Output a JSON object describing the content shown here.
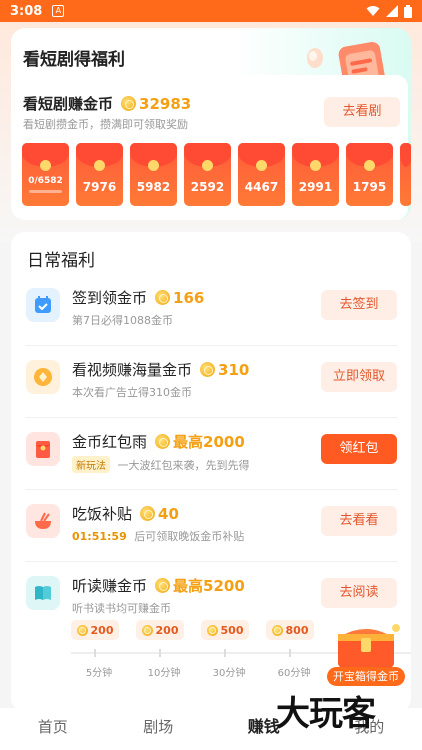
{
  "status_bar": {
    "time": "3:08",
    "a_badge": "A",
    "icons": [
      "wifi-icon",
      "signal-icon",
      "battery-icon"
    ]
  },
  "drama_card": {
    "title": "看短剧得福利",
    "earn_label": "看短剧赚金币",
    "coins": "32983",
    "subtitle": "看短剧攒金币，攒满即可领取奖励",
    "button": "去看剧",
    "envelopes": [
      {
        "value": "0/6582",
        "progress": 0
      },
      {
        "value": "7976"
      },
      {
        "value": "5982"
      },
      {
        "value": "2592"
      },
      {
        "value": "4467"
      },
      {
        "value": "2991"
      },
      {
        "value": "1795"
      }
    ]
  },
  "daily": {
    "title": "日常福利",
    "tasks": [
      {
        "title": "签到领金币",
        "reward": "166",
        "desc": "第7日必得1088金币",
        "button": "去签到",
        "icon": "calendar-icon"
      },
      {
        "title": "看视频赚海量金币",
        "reward": "310",
        "desc": "本次看广告立得310金币",
        "button": "立即领取",
        "icon": "video-coin-icon"
      },
      {
        "title": "金币红包雨",
        "reward": "最高2000",
        "tag": "新玩法",
        "desc": "一大波红包来袭，先到先得",
        "button": "领红包",
        "icon": "red-packet-icon"
      },
      {
        "title": "吃饭补贴",
        "reward": "40",
        "timer": "01:51:59",
        "desc": "后可领取晚饭金币补贴",
        "button": "去看看",
        "icon": "bowl-icon"
      },
      {
        "title": "听读赚金币",
        "reward": "最高5200",
        "desc": "听书读书均可赚金币",
        "button": "去阅读",
        "icon": "book-icon"
      }
    ],
    "listen_chips": [
      "200",
      "200",
      "500",
      "800"
    ],
    "listen_times": [
      "5分钟",
      "10分钟",
      "30分钟",
      "60分钟"
    ]
  },
  "treasure": {
    "label": "开宝箱得金币"
  },
  "bottom_nav": {
    "items": [
      "首页",
      "剧场",
      "赚钱",
      "我的"
    ],
    "active": 2
  },
  "watermark": "大玩客",
  "colors": {
    "accent": "#ff6a1a",
    "gold": "#f5a012",
    "button_bg": "#ffeee6"
  }
}
